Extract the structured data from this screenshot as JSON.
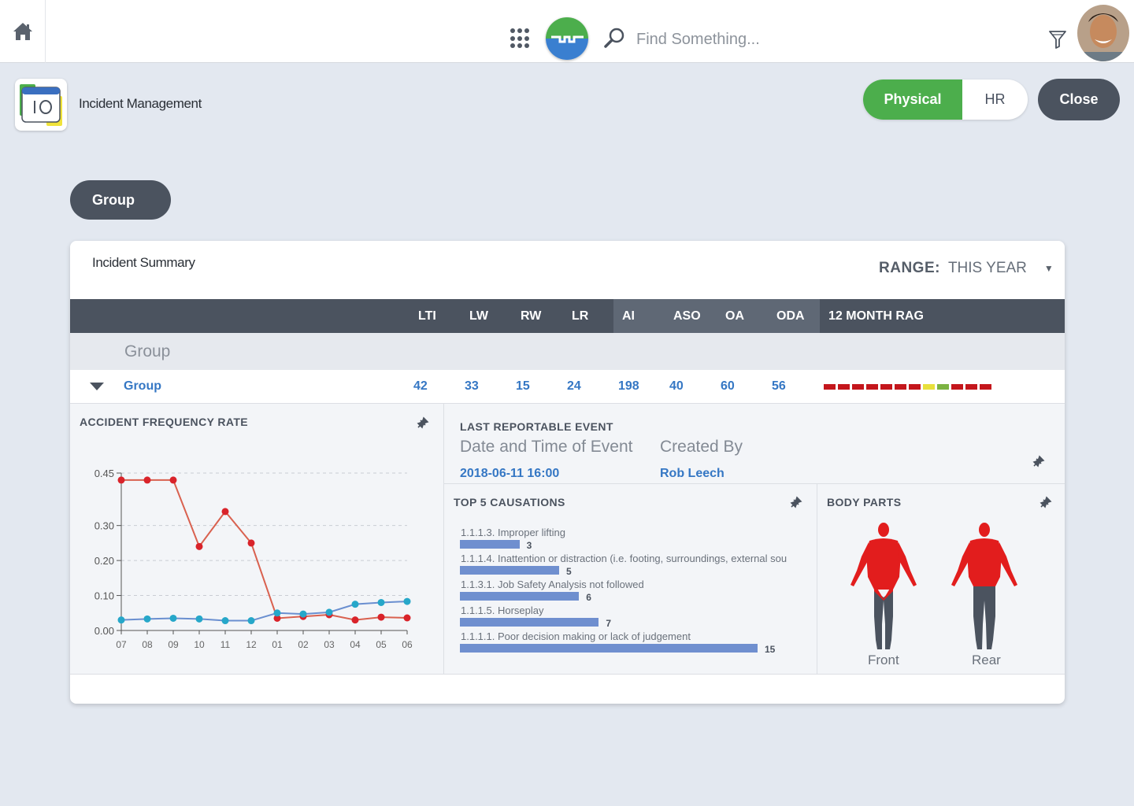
{
  "topbar": {
    "search_placeholder": "Find Something...",
    "icons": [
      "home-icon",
      "apps-grid-icon",
      "search-icon",
      "filter-icon"
    ]
  },
  "app": {
    "title": "Incident Management",
    "segment": {
      "physical": "Physical",
      "hr": "HR",
      "active": "Physical"
    },
    "close_label": "Close",
    "group_button": "Group"
  },
  "card": {
    "title": "Incident Summary",
    "range_label": "RANGE:",
    "range_value": "THIS YEAR",
    "columns": [
      "LTI",
      "LW",
      "RW",
      "LR",
      "AI",
      "ASO",
      "OA",
      "ODA",
      "12 MONTH RAG"
    ],
    "group_header": "Group",
    "row": {
      "name": "Group",
      "values": [
        "42",
        "33",
        "15",
        "24",
        "198",
        "40",
        "60",
        "56"
      ],
      "rag": [
        "red",
        "red",
        "red",
        "red",
        "red",
        "red",
        "red",
        "yellow",
        "green",
        "red",
        "red",
        "red"
      ]
    },
    "colors": {
      "red": "#c4161c",
      "yellow": "#e8e03c",
      "green": "#7cb342",
      "accent_blue": "#3577c4",
      "dark": "#4b535f"
    }
  },
  "afr": {
    "title": "ACCIDENT FREQUENCY RATE"
  },
  "chart_data": {
    "type": "line",
    "title": "ACCIDENT FREQUENCY RATE",
    "categories": [
      "07",
      "08",
      "09",
      "10",
      "11",
      "12",
      "01",
      "02",
      "03",
      "04",
      "05",
      "06"
    ],
    "y_ticks": [
      "0.00",
      "0.10",
      "0.20",
      "0.30",
      "0.45"
    ],
    "ylim": [
      0,
      0.45
    ],
    "grid": true,
    "series": [
      {
        "color": "#d9534f",
        "values": [
          0.43,
          0.43,
          0.43,
          0.24,
          0.34,
          0.25,
          0.035,
          0.04,
          0.045,
          0.03,
          0.038,
          0.036
        ]
      },
      {
        "color": "#26a7c9",
        "values": [
          0.03,
          0.033,
          0.035,
          0.033,
          0.028,
          0.028,
          0.05,
          0.047,
          0.052,
          0.075,
          0.08,
          0.083
        ]
      }
    ]
  },
  "last_event": {
    "title": "LAST REPORTABLE EVENT",
    "date_label": "Date and Time of Event",
    "date_value": "2018-06-11 16:00",
    "created_label": "Created By",
    "created_value": "Rob Leech"
  },
  "causations": {
    "title": "TOP 5 CAUSATIONS",
    "max": 15,
    "items": [
      {
        "label": "1.1.1.3. Improper lifting",
        "value": 3
      },
      {
        "label": "1.1.1.4. Inattention or distraction (i.e. footing, surroundings, external sou",
        "value": 5
      },
      {
        "label": "1.1.3.1. Job Safety Analysis not followed",
        "value": 6
      },
      {
        "label": "1.1.1.5. Horseplay",
        "value": 7
      },
      {
        "label": "1.1.1.1. Poor decision making or lack of judgement",
        "value": 15
      }
    ]
  },
  "body_parts": {
    "title": "BODY PARTS",
    "front_label": "Front",
    "rear_label": "Rear"
  }
}
